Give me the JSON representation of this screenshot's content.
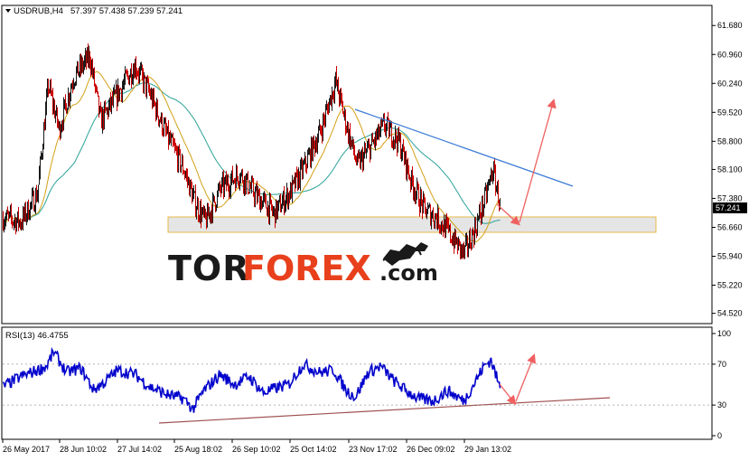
{
  "header": {
    "symbol": "USDRUB,H4",
    "ohlc": "57.397 57.438 57.239 57.241",
    "dropdown_icon": "triangle-down-icon"
  },
  "rsi_header": "RSI(13) 46.4755",
  "logo": {
    "part1": "TOR",
    "part2": "FOREX",
    "part3": ".com",
    "brand_color": "#e8401c",
    "icon": "bull-bear-icon"
  },
  "price_marker": "57.241",
  "colors": {
    "candle_up": "#1a1a1a",
    "candle_down": "#cc0000",
    "ma_fast": "#d4a017",
    "ma_slow": "#2aa198",
    "trendline": "#3a7bd5",
    "rsi_line": "#0000cc",
    "rsi_support": "#a05050",
    "arrow": "#f06060",
    "zone_fill": "#dcdcdc",
    "zone_border": "#e8b84a"
  },
  "chart_data": [
    {
      "type": "candlestick",
      "title": "USDRUB,H4",
      "y_ticks": [
        "61.680",
        "60.960",
        "60.240",
        "59.520",
        "58.800",
        "58.100",
        "57.380",
        "56.660",
        "55.940",
        "55.220",
        "54.520"
      ],
      "ylim": [
        54.4,
        62.0
      ],
      "x_ticks": [
        "26 May 2017",
        "28 Jun 10:02",
        "27 Jul 14:02",
        "25 Aug 18:02",
        "26 Sep 10:02",
        "25 Oct 14:02",
        "23 Nov 17:02",
        "26 Dec 09:02",
        "29 Jan 13:02"
      ],
      "anchors": [
        [
          0,
          56.9
        ],
        [
          20,
          56.8
        ],
        [
          38,
          57.5
        ],
        [
          50,
          60.2
        ],
        [
          62,
          59.1
        ],
        [
          78,
          60.4
        ],
        [
          96,
          60.9
        ],
        [
          108,
          59.3
        ],
        [
          122,
          59.8
        ],
        [
          146,
          60.7
        ],
        [
          162,
          60.0
        ],
        [
          182,
          58.9
        ],
        [
          200,
          58.1
        ],
        [
          212,
          57.3
        ],
        [
          224,
          56.8
        ],
        [
          240,
          57.6
        ],
        [
          262,
          58.0
        ],
        [
          278,
          57.5
        ],
        [
          300,
          57.0
        ],
        [
          320,
          57.6
        ],
        [
          334,
          58.2
        ],
        [
          352,
          59.1
        ],
        [
          368,
          60.3
        ],
        [
          380,
          59.2
        ],
        [
          392,
          58.2
        ],
        [
          408,
          58.7
        ],
        [
          422,
          59.2
        ],
        [
          438,
          58.8
        ],
        [
          452,
          57.8
        ],
        [
          466,
          57.1
        ],
        [
          480,
          56.9
        ],
        [
          494,
          56.5
        ],
        [
          510,
          56.0
        ],
        [
          522,
          56.6
        ],
        [
          534,
          57.4
        ],
        [
          542,
          58.1
        ],
        [
          550,
          57.241
        ]
      ]
    },
    {
      "type": "line",
      "title": "RSI(13) 46.4755",
      "y_ticks": [
        "100",
        "70",
        "30",
        "0"
      ],
      "ylim": [
        0,
        100
      ],
      "anchors": [
        [
          0,
          48
        ],
        [
          20,
          58
        ],
        [
          38,
          64
        ],
        [
          48,
          68
        ],
        [
          56,
          82
        ],
        [
          70,
          62
        ],
        [
          86,
          66
        ],
        [
          100,
          45
        ],
        [
          112,
          52
        ],
        [
          126,
          64
        ],
        [
          146,
          60
        ],
        [
          162,
          48
        ],
        [
          182,
          40
        ],
        [
          200,
          36
        ],
        [
          210,
          26
        ],
        [
          222,
          44
        ],
        [
          240,
          60
        ],
        [
          256,
          50
        ],
        [
          272,
          58
        ],
        [
          288,
          42
        ],
        [
          300,
          46
        ],
        [
          316,
          50
        ],
        [
          332,
          70
        ],
        [
          350,
          62
        ],
        [
          366,
          64
        ],
        [
          380,
          44
        ],
        [
          390,
          38
        ],
        [
          404,
          62
        ],
        [
          418,
          68
        ],
        [
          432,
          54
        ],
        [
          446,
          44
        ],
        [
          460,
          36
        ],
        [
          476,
          34
        ],
        [
          492,
          44
        ],
        [
          510,
          34
        ],
        [
          522,
          52
        ],
        [
          532,
          68
        ],
        [
          540,
          74
        ],
        [
          550,
          46.4755
        ]
      ]
    }
  ]
}
